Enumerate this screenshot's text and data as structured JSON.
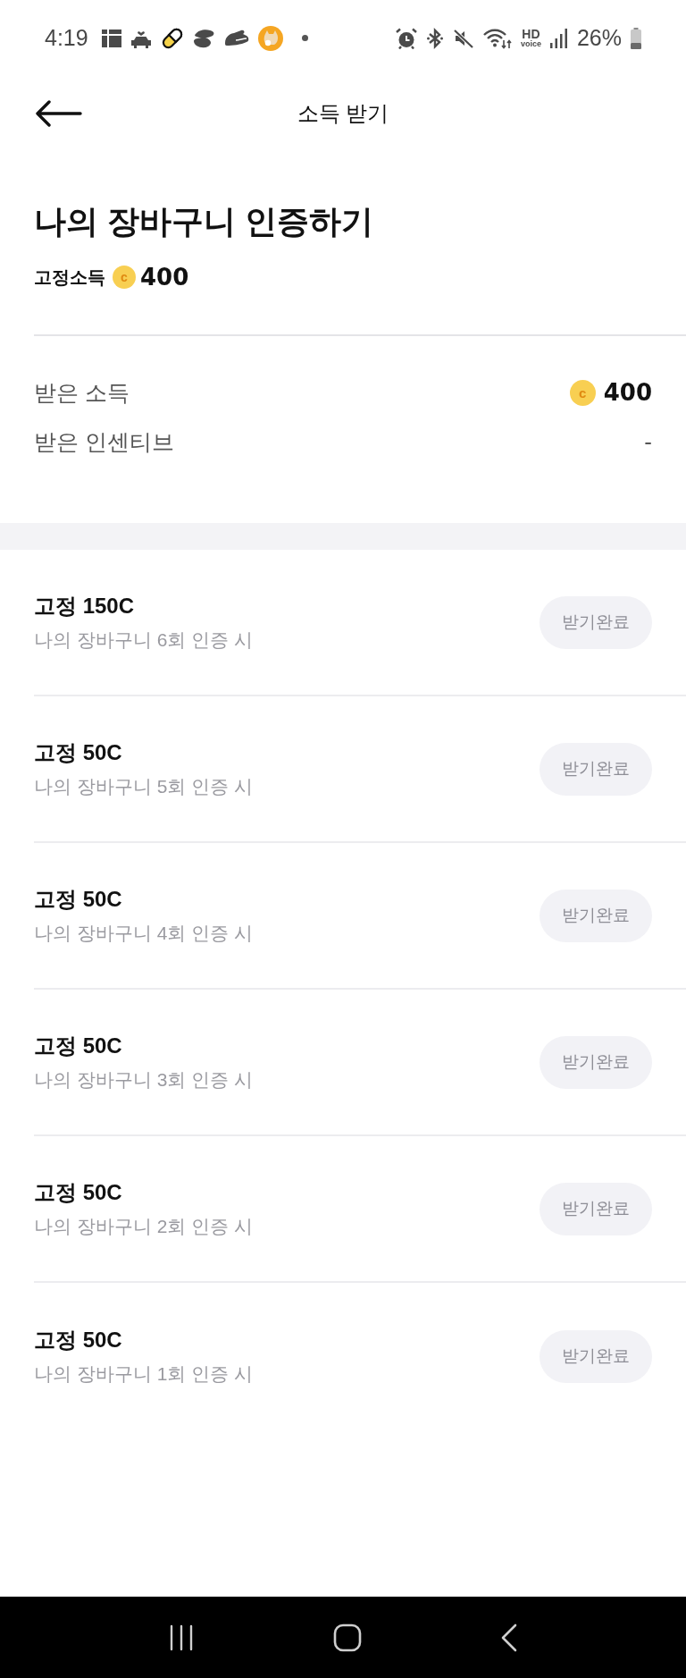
{
  "status_bar": {
    "time": "4:19",
    "hd": "HD",
    "hd_sub": "voice",
    "battery_percent": "26%"
  },
  "header": {
    "title": "소득 받기"
  },
  "mission": {
    "title": "나의 장바구니 인증하기",
    "fixed_income_label": "고정소득",
    "coin": "c",
    "fixed_income_amount": "400"
  },
  "summary": [
    {
      "label": "받은 소득",
      "coin": "c",
      "value": "400"
    },
    {
      "label": "받은 인센티브",
      "value": "-"
    }
  ],
  "rewards": [
    {
      "title": "고정 150C",
      "condition": "나의 장바구니 6회 인증 시",
      "button": "받기완료",
      "disabled": true
    },
    {
      "title": "고정 50C",
      "condition": "나의 장바구니 5회 인증 시",
      "button": "받기완료",
      "disabled": true
    },
    {
      "title": "고정 50C",
      "condition": "나의 장바구니 4회 인증 시",
      "button": "받기완료",
      "disabled": true
    },
    {
      "title": "고정 50C",
      "condition": "나의 장바구니 3회 인증 시",
      "button": "받기완료",
      "disabled": true
    },
    {
      "title": "고정 50C",
      "condition": "나의 장바구니 2회 인증 시",
      "button": "받기완료",
      "disabled": true
    },
    {
      "title": "고정 50C",
      "condition": "나의 장바구니 1회 인증 시",
      "button": "받기완료",
      "disabled": true
    }
  ]
}
